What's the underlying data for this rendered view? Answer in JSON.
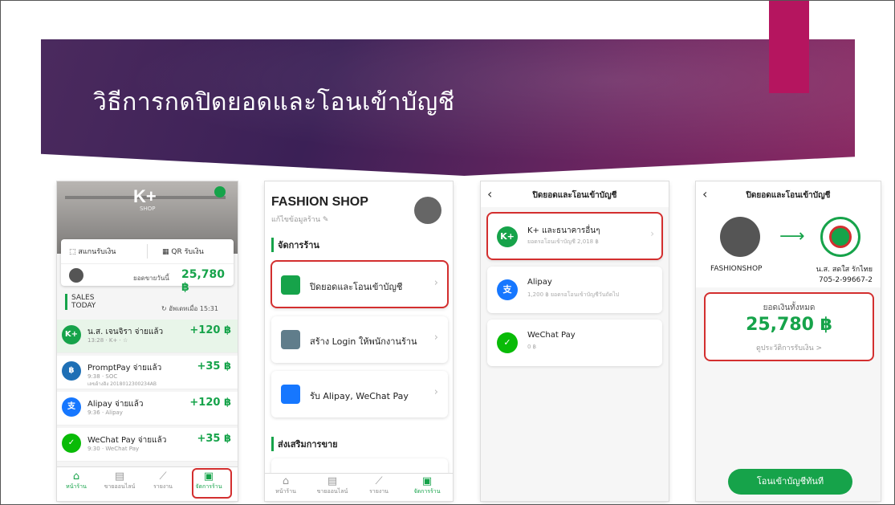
{
  "slide": {
    "title": "วิธีการกดปิดยอดและโอนเข้าบัญชี"
  },
  "colors": {
    "accent": "#b5155f",
    "brand_green": "#16a34a",
    "highlight_red": "#d32f2f"
  },
  "screen1": {
    "logo": "K+",
    "logo_sub": "SHOP",
    "scan_label": "สแกนรับเงิน",
    "qr_label": "QR รับเงิน",
    "today_label": "ยอดขายวันนี้",
    "today_total": "25,780 ฿",
    "sales_title": "SALES",
    "sales_sub": "TODAY",
    "updated": "อัพเดทเมื่อ 15:31",
    "transactions": [
      {
        "icon": "K+",
        "title": "น.ส. เจนจิรา จ่ายแล้ว",
        "sub": "13:28 · K+ · ☆",
        "sub2": "",
        "amount": "+120 ฿",
        "color": "#16a34a"
      },
      {
        "icon": "฿",
        "title": "PromptPay จ่ายแล้ว",
        "sub": "9:38 · SOC",
        "sub2": "เลขอ้างอิง 2018012300234AB",
        "amount": "+35 ฿",
        "color": "#1e6fb5"
      },
      {
        "icon": "支",
        "title": "Alipay จ่ายแล้ว",
        "sub": "9:36 · Alipay",
        "sub2": "",
        "amount": "+120 ฿",
        "color": "#1677ff"
      },
      {
        "icon": "✓",
        "title": "WeChat Pay จ่ายแล้ว",
        "sub": "9:30 · WeChat Pay",
        "sub2": "",
        "amount": "+35 ฿",
        "color": "#09bb07"
      }
    ],
    "nav": [
      "หน้าร้าน",
      "ขายออนไลน์",
      "รายงาน",
      "จัดการร้าน"
    ]
  },
  "screen2": {
    "shop_name": "FASHION SHOP",
    "edit_label": "แก้ไขข้อมูลร้าน ✎",
    "section1": "จัดการร้าน",
    "items": [
      "ปิดยอดและโอนเข้าบัญชี",
      "สร้าง Login ให้พนักงานร้าน",
      "รับ Alipay, WeChat Pay"
    ],
    "section2": "ส่งเสริมการขาย",
    "nav": [
      "หน้าร้าน",
      "ขายออนไลน์",
      "รายงาน",
      "จัดการร้าน"
    ]
  },
  "screen3": {
    "title": "ปิดยอดและโอนเข้าบัญชี",
    "channels": [
      {
        "icon": "K+",
        "name": "K+ และธนาคารอื่นๆ",
        "sub": "ยอดรอโอนเข้าบัญชี 2,018 ฿",
        "color": "#16a34a"
      },
      {
        "icon": "支",
        "name": "Alipay",
        "sub": "1,200 ฿ ยอดรอโอนเข้าบัญชีวันถัดไป",
        "color": "#1677ff"
      },
      {
        "icon": "✓",
        "name": "WeChat Pay",
        "sub": "0 ฿",
        "color": "#09bb07"
      }
    ]
  },
  "screen4": {
    "title": "ปิดยอดและโอนเข้าบัญชี",
    "shop_name": "FASHIONSHOP",
    "account_name": "น.ส. สดใส รักไทย",
    "account_no": "705-2-99667-2",
    "total_label": "ยอดเงินทั้งหมด",
    "total": "25,780 ฿",
    "history_link": "ดูประวัติการรับเงิน >",
    "transfer_button": "โอนเข้าบัญชีทันที"
  }
}
